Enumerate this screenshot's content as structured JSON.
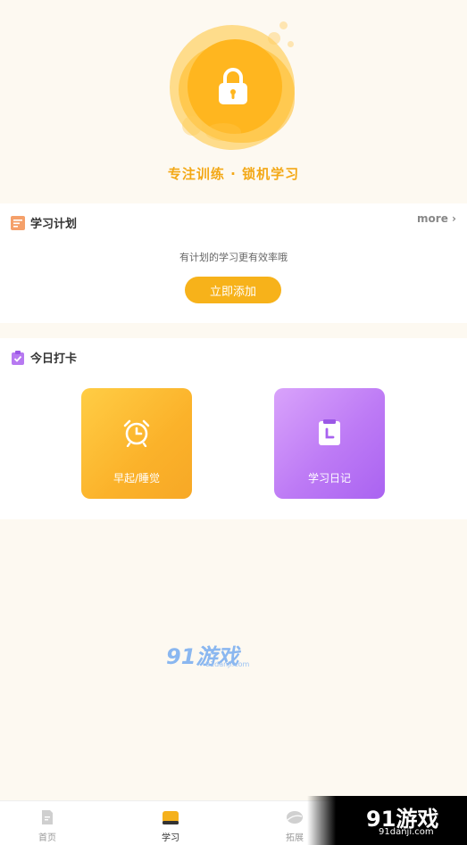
{
  "hero": {
    "title": "专注训练 · 锁机学习",
    "icon": "lock-icon"
  },
  "plan": {
    "title": "学习计划",
    "more": "more",
    "hint": "有计划的学习更有效率哦",
    "add_button": "立即添加",
    "icon": "document-icon"
  },
  "checkin": {
    "title": "今日打卡",
    "icon": "clipboard-icon",
    "tiles": [
      {
        "label": "早起/睡觉",
        "icon": "alarm-clock-icon"
      },
      {
        "label": "学习日记",
        "icon": "diary-icon"
      }
    ]
  },
  "nav": {
    "items": [
      {
        "label": "首页",
        "icon": "home-doc-icon",
        "active": false
      },
      {
        "label": "学习",
        "icon": "book-icon",
        "active": true
      },
      {
        "label": "拓展",
        "icon": "leaf-icon",
        "active": false
      }
    ]
  },
  "watermark": {
    "center_logo": "91游戏",
    "center_url": "91danji.com",
    "corner_logo": "91游戏",
    "corner_url": "91danji.com"
  },
  "colors": {
    "accent": "#f7b21a",
    "purple": "#b370f3",
    "background": "#fdf9f1"
  }
}
